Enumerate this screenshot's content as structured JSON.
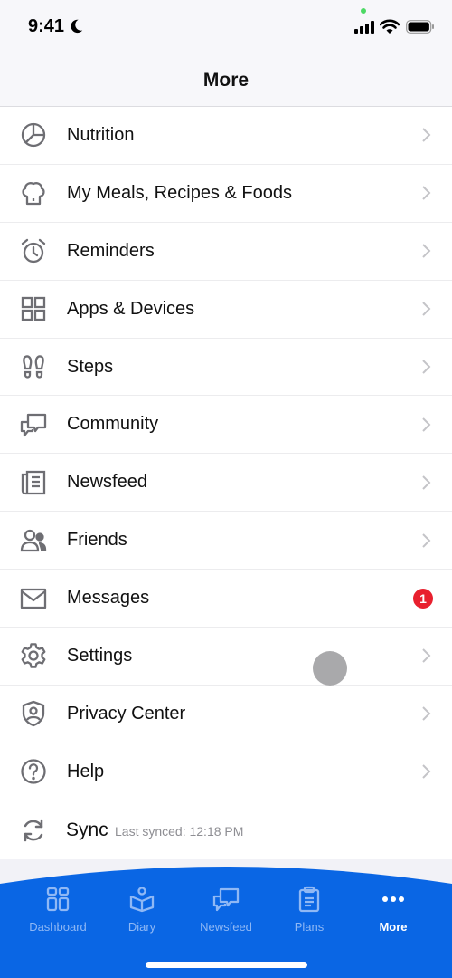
{
  "status_bar": {
    "time": "9:41",
    "focus_icon": "moon-icon",
    "signal_icon": "cellular-signal-icon",
    "wifi_icon": "wifi-icon",
    "battery_icon": "battery-icon"
  },
  "header": {
    "title": "More"
  },
  "menu": {
    "items": [
      {
        "label": "Nutrition",
        "icon": "pie-chart-icon"
      },
      {
        "label": "My Meals, Recipes & Foods",
        "icon": "chef-hat-icon"
      },
      {
        "label": "Reminders",
        "icon": "alarm-clock-icon"
      },
      {
        "label": "Apps & Devices",
        "icon": "grid-icon"
      },
      {
        "label": "Steps",
        "icon": "footprints-icon"
      },
      {
        "label": "Community",
        "icon": "chat-bubbles-icon"
      },
      {
        "label": "Newsfeed",
        "icon": "newspaper-icon"
      },
      {
        "label": "Friends",
        "icon": "friends-icon"
      },
      {
        "label": "Messages",
        "icon": "envelope-icon",
        "badge": "1"
      },
      {
        "label": "Settings",
        "icon": "gear-icon"
      },
      {
        "label": "Privacy Center",
        "icon": "shield-user-icon"
      },
      {
        "label": "Help",
        "icon": "question-circle-icon"
      }
    ],
    "sync": {
      "label": "Sync",
      "subtitle": "Last synced: 12:18 PM",
      "icon": "sync-icon"
    }
  },
  "tabbar": {
    "tabs": [
      {
        "label": "Dashboard",
        "icon": "dashboard-icon"
      },
      {
        "label": "Diary",
        "icon": "diary-icon"
      },
      {
        "label": "Newsfeed",
        "icon": "newsfeed-icon"
      },
      {
        "label": "Plans",
        "icon": "clipboard-icon"
      },
      {
        "label": "More",
        "icon": "more-dots-icon",
        "active": true
      }
    ]
  },
  "colors": {
    "accent": "#0a66e4",
    "badge": "#e8202e",
    "icon_gray": "#6e6e73",
    "tab_inactive": "#8fb8f5"
  }
}
